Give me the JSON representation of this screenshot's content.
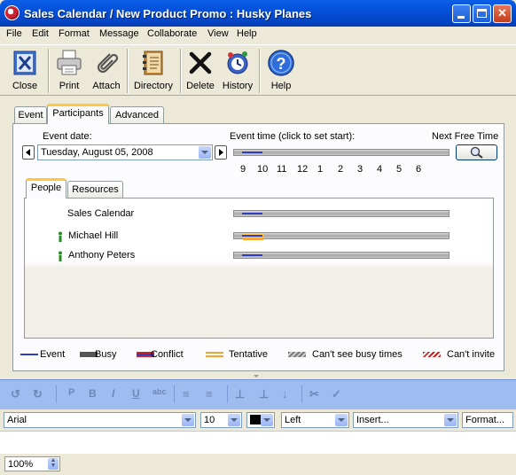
{
  "window": {
    "title": "Sales Calendar / New Product Promo : Husky Planes",
    "minimize": "_",
    "maximize": "□",
    "close": "✕"
  },
  "menu": [
    "File",
    "Edit",
    "Format",
    "Message",
    "Collaborate",
    "View",
    "Help"
  ],
  "toolbar": {
    "close": "Close",
    "print": "Print",
    "attach": "Attach",
    "directory": "Directory",
    "delete": "Delete",
    "history": "History",
    "help": "Help"
  },
  "tabs": {
    "event": "Event",
    "participants": "Participants",
    "advanced": "Advanced"
  },
  "participants": {
    "event_date_label": "Event date:",
    "event_date_value": "Tuesday, August 05, 2008",
    "event_time_label": "Event time (click to set start):",
    "next_free_time_label": "Next Free Time",
    "hours": [
      "9",
      "10",
      "11",
      "12",
      "1",
      "2",
      "3",
      "4",
      "5",
      "6"
    ],
    "subtabs": {
      "people": "People",
      "resources": "Resources"
    },
    "people": [
      {
        "name": "Sales Calendar",
        "icon": "none",
        "status": "event"
      },
      {
        "name": "Michael Hill",
        "icon": "person-icon",
        "status": "tentative"
      },
      {
        "name": "Anthony Peters",
        "icon": "person-icon",
        "status": "event"
      }
    ]
  },
  "legend": {
    "event": "Event",
    "busy": "Busy",
    "conflict": "Conflict",
    "tentative": "Tentative",
    "cant_see": "Can't see busy times",
    "cant_invite": "Can't invite"
  },
  "format": {
    "font": "Arial",
    "size": "10",
    "color": "#000000",
    "align": "Left",
    "insert": "Insert...",
    "format": "Format..."
  },
  "status": {
    "zoom": "100%"
  },
  "colors": {
    "event_line": "#2b3fc4",
    "tentative": "#f7a22c",
    "conflict": "#d02020",
    "active_tab_accent": "#ffc83c",
    "title_bar": "#0550d8"
  }
}
